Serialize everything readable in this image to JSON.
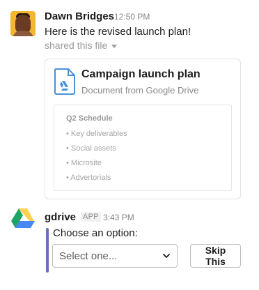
{
  "messages": [
    {
      "sender": "Dawn Bridges",
      "time": "12:50 PM",
      "text": "Here is the revised launch plan!",
      "shared_label": "shared this file",
      "avatar_icon": "user-avatar"
    },
    {
      "sender": "gdrive",
      "app_badge": "APP",
      "time": "3:43 PM",
      "avatar_icon": "google-drive-logo"
    }
  ],
  "file_card": {
    "title": "Campaign launch plan",
    "subtitle": "Document from Google Drive",
    "icon": "google-doc-icon",
    "preview": {
      "heading": "Q2 Schedule",
      "items": [
        "• Key deliverables",
        "• Social assets",
        "• Microsite",
        "• Advertorials"
      ]
    }
  },
  "action": {
    "prompt": "Choose an option:",
    "select_value": "Select one...",
    "skip_label": "Skip This"
  },
  "colors": {
    "attachment_bar": "#6c6fb8",
    "doc_icon_blue": "#4a90d9",
    "drive_green": "#1fa463",
    "drive_yellow": "#ffd04b",
    "drive_blue": "#4688f4"
  }
}
